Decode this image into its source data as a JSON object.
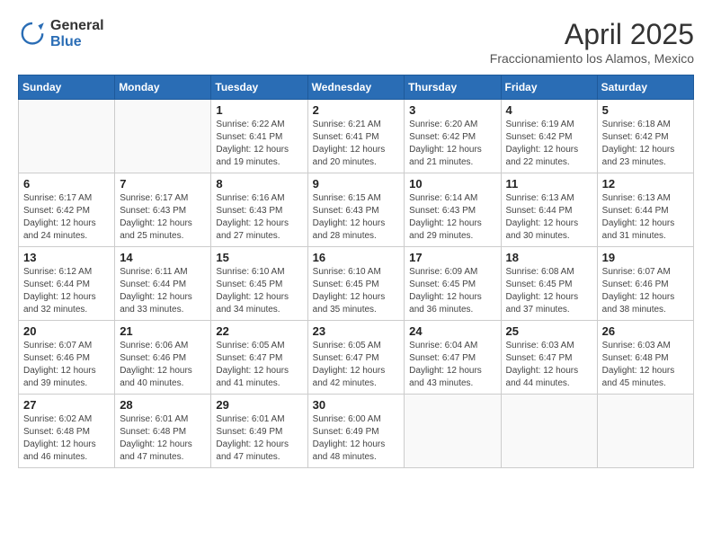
{
  "logo": {
    "general": "General",
    "blue": "Blue"
  },
  "title": "April 2025",
  "subtitle": "Fraccionamiento los Alamos, Mexico",
  "days_header": [
    "Sunday",
    "Monday",
    "Tuesday",
    "Wednesday",
    "Thursday",
    "Friday",
    "Saturday"
  ],
  "weeks": [
    [
      {
        "day": "",
        "info": ""
      },
      {
        "day": "",
        "info": ""
      },
      {
        "day": "1",
        "sunrise": "6:22 AM",
        "sunset": "6:41 PM",
        "daylight": "12 hours and 19 minutes."
      },
      {
        "day": "2",
        "sunrise": "6:21 AM",
        "sunset": "6:41 PM",
        "daylight": "12 hours and 20 minutes."
      },
      {
        "day": "3",
        "sunrise": "6:20 AM",
        "sunset": "6:42 PM",
        "daylight": "12 hours and 21 minutes."
      },
      {
        "day": "4",
        "sunrise": "6:19 AM",
        "sunset": "6:42 PM",
        "daylight": "12 hours and 22 minutes."
      },
      {
        "day": "5",
        "sunrise": "6:18 AM",
        "sunset": "6:42 PM",
        "daylight": "12 hours and 23 minutes."
      }
    ],
    [
      {
        "day": "6",
        "sunrise": "6:17 AM",
        "sunset": "6:42 PM",
        "daylight": "12 hours and 24 minutes."
      },
      {
        "day": "7",
        "sunrise": "6:17 AM",
        "sunset": "6:43 PM",
        "daylight": "12 hours and 25 minutes."
      },
      {
        "day": "8",
        "sunrise": "6:16 AM",
        "sunset": "6:43 PM",
        "daylight": "12 hours and 27 minutes."
      },
      {
        "day": "9",
        "sunrise": "6:15 AM",
        "sunset": "6:43 PM",
        "daylight": "12 hours and 28 minutes."
      },
      {
        "day": "10",
        "sunrise": "6:14 AM",
        "sunset": "6:43 PM",
        "daylight": "12 hours and 29 minutes."
      },
      {
        "day": "11",
        "sunrise": "6:13 AM",
        "sunset": "6:44 PM",
        "daylight": "12 hours and 30 minutes."
      },
      {
        "day": "12",
        "sunrise": "6:13 AM",
        "sunset": "6:44 PM",
        "daylight": "12 hours and 31 minutes."
      }
    ],
    [
      {
        "day": "13",
        "sunrise": "6:12 AM",
        "sunset": "6:44 PM",
        "daylight": "12 hours and 32 minutes."
      },
      {
        "day": "14",
        "sunrise": "6:11 AM",
        "sunset": "6:44 PM",
        "daylight": "12 hours and 33 minutes."
      },
      {
        "day": "15",
        "sunrise": "6:10 AM",
        "sunset": "6:45 PM",
        "daylight": "12 hours and 34 minutes."
      },
      {
        "day": "16",
        "sunrise": "6:10 AM",
        "sunset": "6:45 PM",
        "daylight": "12 hours and 35 minutes."
      },
      {
        "day": "17",
        "sunrise": "6:09 AM",
        "sunset": "6:45 PM",
        "daylight": "12 hours and 36 minutes."
      },
      {
        "day": "18",
        "sunrise": "6:08 AM",
        "sunset": "6:45 PM",
        "daylight": "12 hours and 37 minutes."
      },
      {
        "day": "19",
        "sunrise": "6:07 AM",
        "sunset": "6:46 PM",
        "daylight": "12 hours and 38 minutes."
      }
    ],
    [
      {
        "day": "20",
        "sunrise": "6:07 AM",
        "sunset": "6:46 PM",
        "daylight": "12 hours and 39 minutes."
      },
      {
        "day": "21",
        "sunrise": "6:06 AM",
        "sunset": "6:46 PM",
        "daylight": "12 hours and 40 minutes."
      },
      {
        "day": "22",
        "sunrise": "6:05 AM",
        "sunset": "6:47 PM",
        "daylight": "12 hours and 41 minutes."
      },
      {
        "day": "23",
        "sunrise": "6:05 AM",
        "sunset": "6:47 PM",
        "daylight": "12 hours and 42 minutes."
      },
      {
        "day": "24",
        "sunrise": "6:04 AM",
        "sunset": "6:47 PM",
        "daylight": "12 hours and 43 minutes."
      },
      {
        "day": "25",
        "sunrise": "6:03 AM",
        "sunset": "6:47 PM",
        "daylight": "12 hours and 44 minutes."
      },
      {
        "day": "26",
        "sunrise": "6:03 AM",
        "sunset": "6:48 PM",
        "daylight": "12 hours and 45 minutes."
      }
    ],
    [
      {
        "day": "27",
        "sunrise": "6:02 AM",
        "sunset": "6:48 PM",
        "daylight": "12 hours and 46 minutes."
      },
      {
        "day": "28",
        "sunrise": "6:01 AM",
        "sunset": "6:48 PM",
        "daylight": "12 hours and 47 minutes."
      },
      {
        "day": "29",
        "sunrise": "6:01 AM",
        "sunset": "6:49 PM",
        "daylight": "12 hours and 47 minutes."
      },
      {
        "day": "30",
        "sunrise": "6:00 AM",
        "sunset": "6:49 PM",
        "daylight": "12 hours and 48 minutes."
      },
      {
        "day": "",
        "info": ""
      },
      {
        "day": "",
        "info": ""
      },
      {
        "day": "",
        "info": ""
      }
    ]
  ],
  "labels": {
    "sunrise": "Sunrise:",
    "sunset": "Sunset:",
    "daylight": "Daylight:"
  }
}
